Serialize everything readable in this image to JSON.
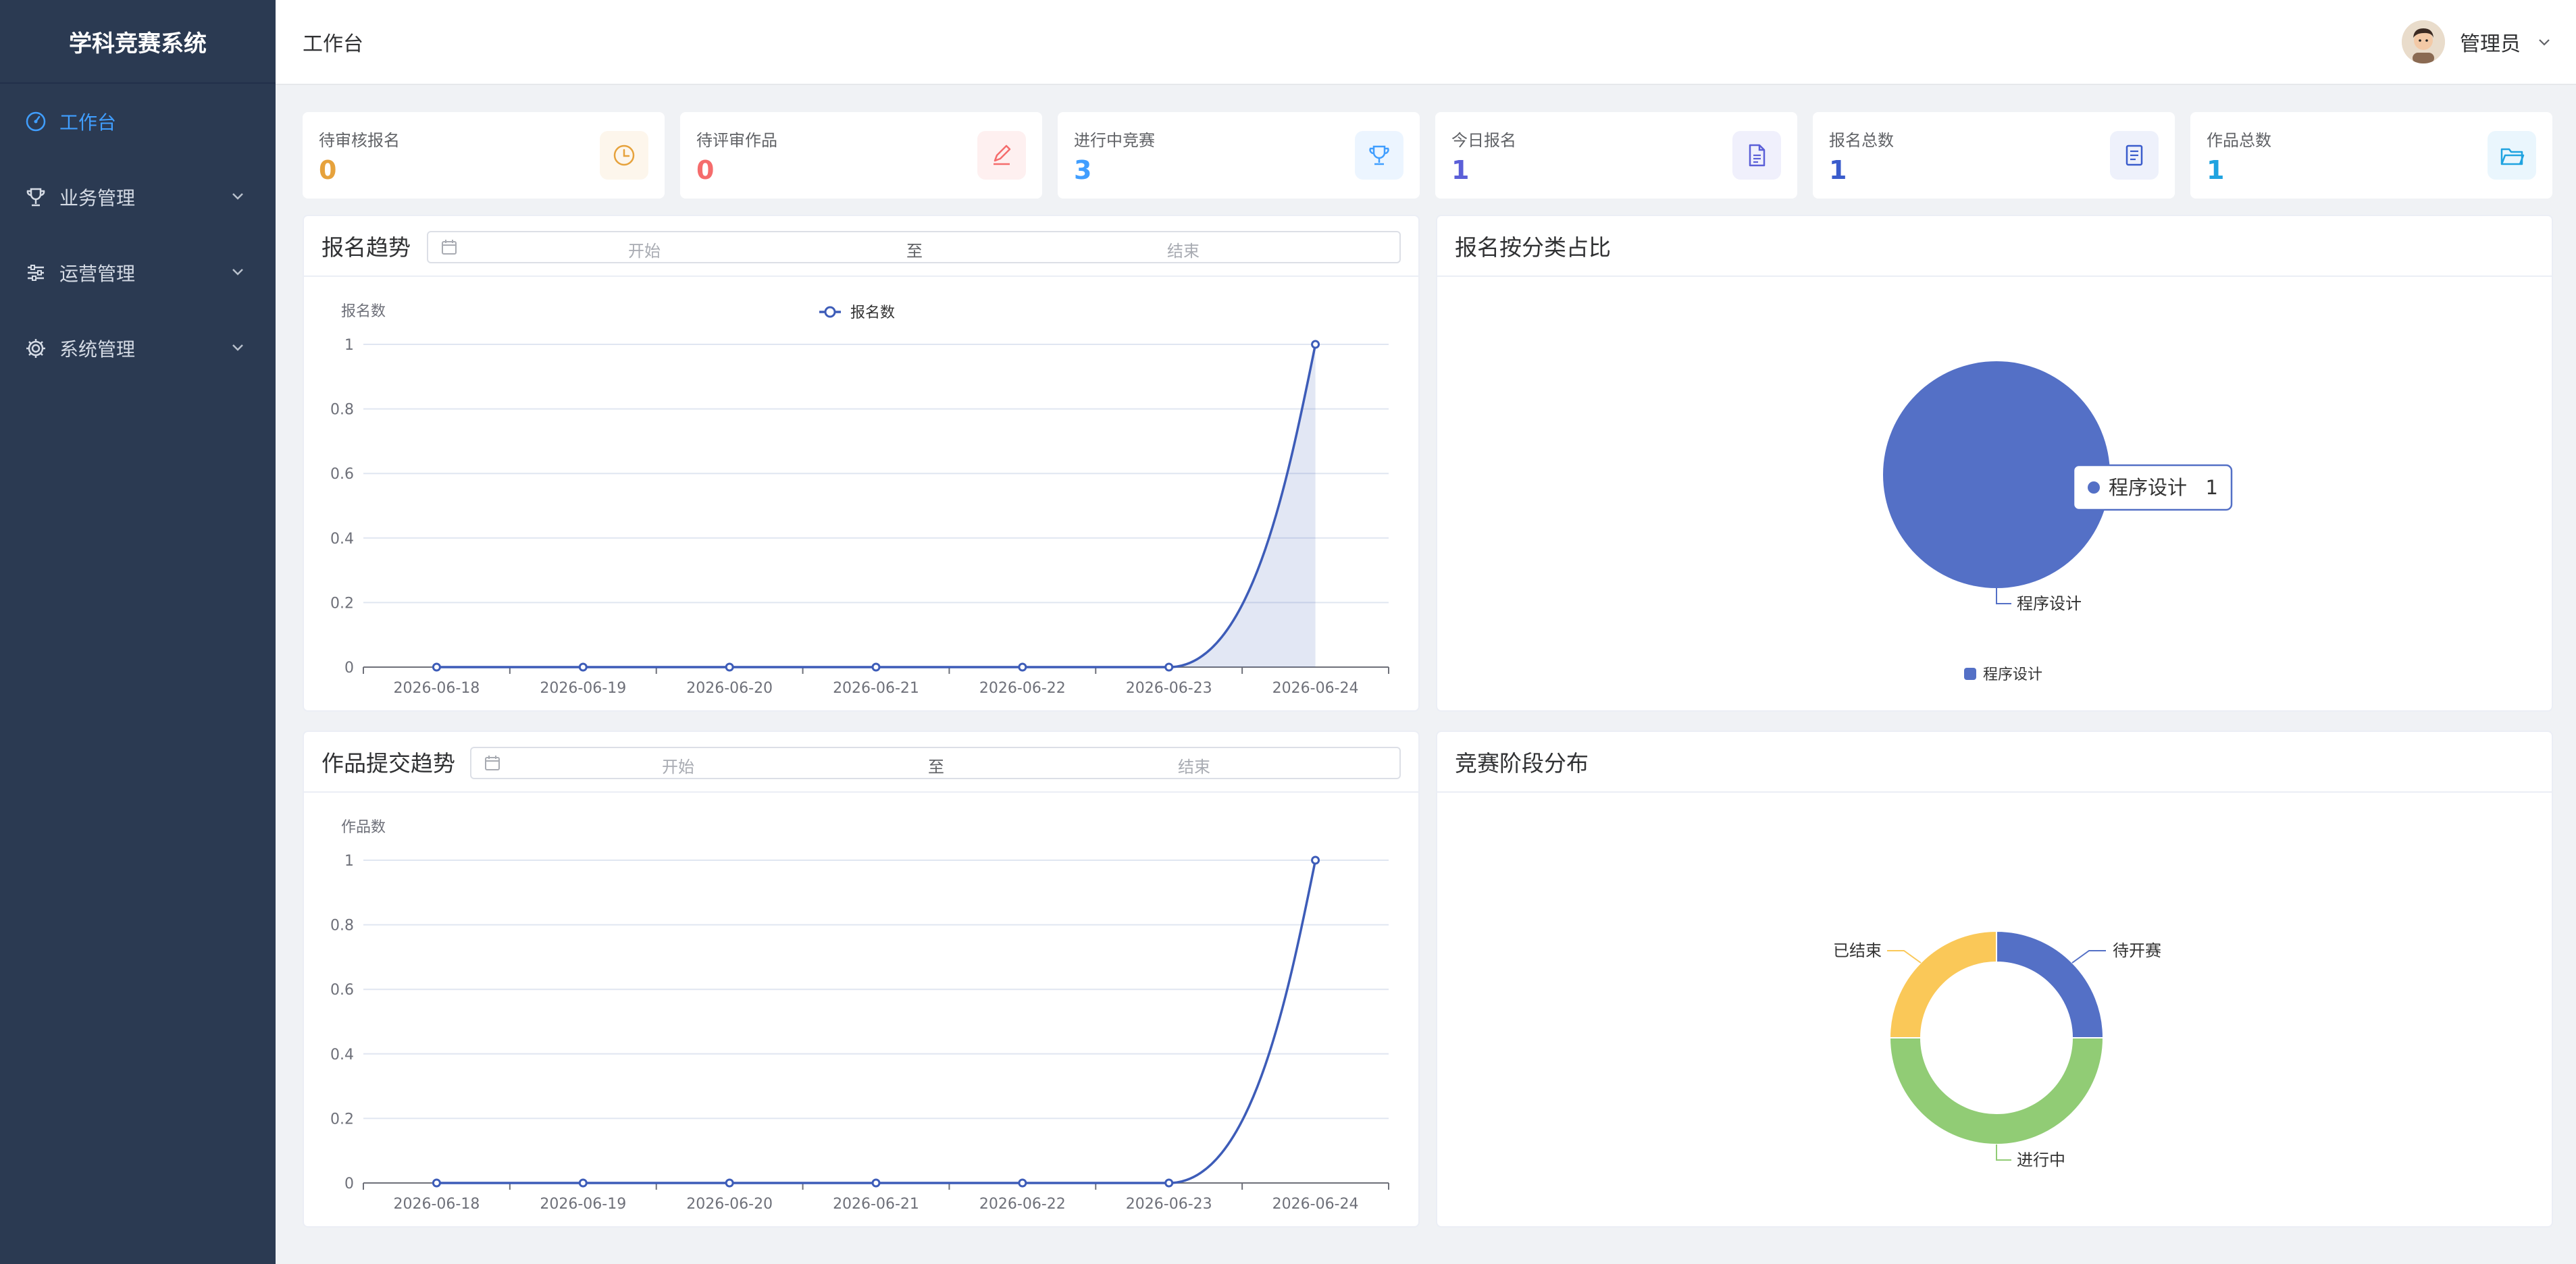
{
  "app": {
    "title": "学科竞赛系统"
  },
  "sidebar": {
    "items": [
      {
        "label": "工作台",
        "icon": "gauge-icon"
      },
      {
        "label": "业务管理",
        "icon": "trophy-icon"
      },
      {
        "label": "运营管理",
        "icon": "sliders-icon"
      },
      {
        "label": "系统管理",
        "icon": "gear-icon"
      }
    ]
  },
  "header": {
    "title": "工作台",
    "user": "管理员"
  },
  "stats": [
    {
      "label": "待审核报名",
      "value": "0",
      "color": "#e6a23c",
      "icon": "clock-icon",
      "bg": "#fdf6ec"
    },
    {
      "label": "待评审作品",
      "value": "0",
      "color": "#f56c6c",
      "icon": "pen-icon",
      "bg": "#fef0f0"
    },
    {
      "label": "进行中竞赛",
      "value": "3",
      "color": "#409eff",
      "icon": "trophy-icon",
      "bg": "#ecf5ff"
    },
    {
      "label": "今日报名",
      "value": "1",
      "color": "#5b5fd8",
      "icon": "document-icon",
      "bg": "#f0f0fc"
    },
    {
      "label": "报名总数",
      "value": "1",
      "color": "#3a5ccc",
      "icon": "list-icon",
      "bg": "#eef1fb"
    },
    {
      "label": "作品总数",
      "value": "1",
      "color": "#1fa3e0",
      "icon": "folder-icon",
      "bg": "#eaf6fd"
    }
  ],
  "range": {
    "start": "开始",
    "to": "至",
    "end": "结束"
  },
  "cards": {
    "reg_trend": "报名趋势",
    "category": "报名按分类占比",
    "submit_trend": "作品提交趋势",
    "stages": "竞赛阶段分布"
  },
  "chart_data": [
    {
      "type": "area",
      "title": "报名趋势",
      "ylabel": "报名数",
      "legend": [
        "报名数"
      ],
      "legend_position": "top-center",
      "categories": [
        "2026-06-18",
        "2026-06-19",
        "2026-06-20",
        "2026-06-21",
        "2026-06-22",
        "2026-06-23",
        "2026-06-24"
      ],
      "series": [
        {
          "name": "报名数",
          "values": [
            0,
            0,
            0,
            0,
            0,
            0,
            1
          ]
        }
      ],
      "yticks": [
        "0",
        "0.2",
        "0.4",
        "0.6",
        "0.8",
        "1"
      ],
      "ylim": [
        0,
        1
      ],
      "grid": true,
      "color": "#3d5cb8"
    },
    {
      "type": "pie",
      "title": "报名按分类占比",
      "slices": [
        {
          "name": "程序设计",
          "value": 1,
          "color": "#5470c6"
        }
      ],
      "legend_position": "bottom-center",
      "tooltip": {
        "name": "程序设计",
        "value": "1"
      }
    },
    {
      "type": "line",
      "title": "作品提交趋势",
      "ylabel": "作品数",
      "categories": [
        "2026-06-18",
        "2026-06-19",
        "2026-06-20",
        "2026-06-21",
        "2026-06-22",
        "2026-06-23",
        "2026-06-24"
      ],
      "series": [
        {
          "values": [
            0,
            0,
            0,
            0,
            0,
            0,
            1
          ]
        }
      ],
      "yticks": [
        "0",
        "0.2",
        "0.4",
        "0.6",
        "0.8",
        "1"
      ],
      "ylim": [
        0,
        1
      ],
      "grid": true,
      "color": "#3d5cb8"
    },
    {
      "type": "pie",
      "title": "竞赛阶段分布",
      "donut": true,
      "slices": [
        {
          "name": "待开赛",
          "value": 1,
          "color": "#5470c6"
        },
        {
          "name": "进行中",
          "value": 2,
          "color": "#91cc75"
        },
        {
          "name": "已结束",
          "value": 1,
          "color": "#fac858"
        }
      ],
      "legend_position": "bottom-center"
    }
  ]
}
